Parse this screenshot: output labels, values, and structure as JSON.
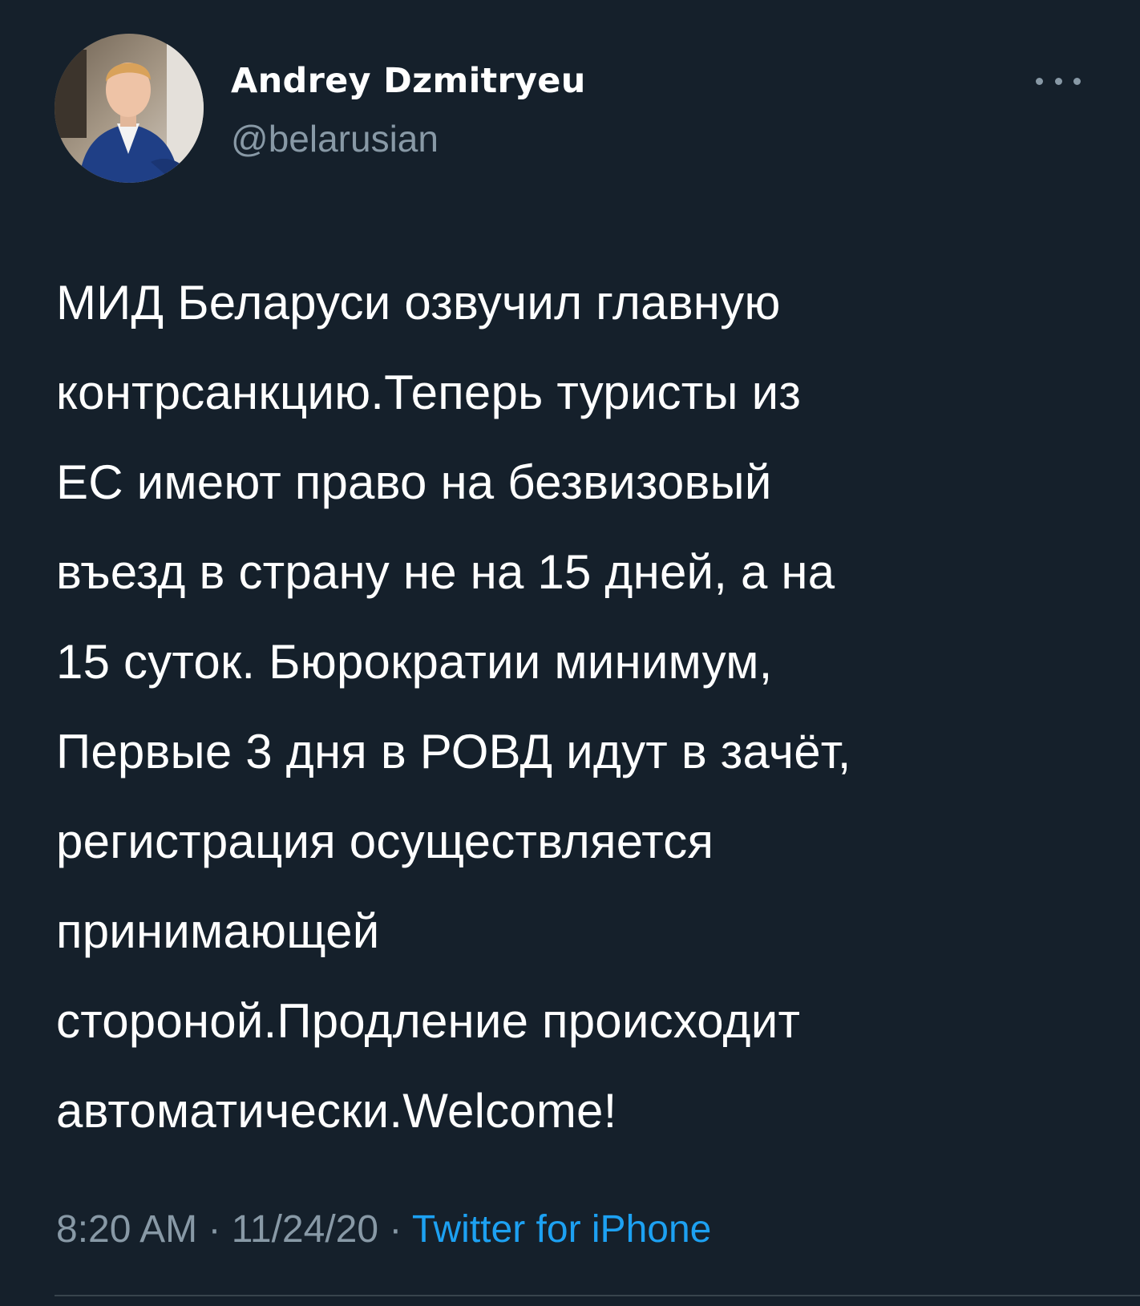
{
  "author": {
    "name": "Andrey Dzmitryeu",
    "handle": "@belarusian"
  },
  "more_menu": {
    "icon": "more-horizontal-icon"
  },
  "tweet": {
    "text": "МИД Беларуси озвучил главную\nконтрсанкцию.Теперь туристы из\nЕС имеют право на безвизовый\nвъезд в страну не на 15 дней, а на\n15 суток. Бюрократии минимум,\nПервые 3 дня в РОВД идут в зачёт,\nрегистрация осуществляется\nпринимающей\nстороной.Продление происходит\nавтоматически.Welcome!"
  },
  "meta": {
    "time": "8:20 AM",
    "separator": " · ",
    "date": "11/24/20",
    "source": "Twitter for iPhone"
  },
  "colors": {
    "background": "#15202b",
    "secondary_text": "#8899a6",
    "accent": "#1da1f2"
  }
}
